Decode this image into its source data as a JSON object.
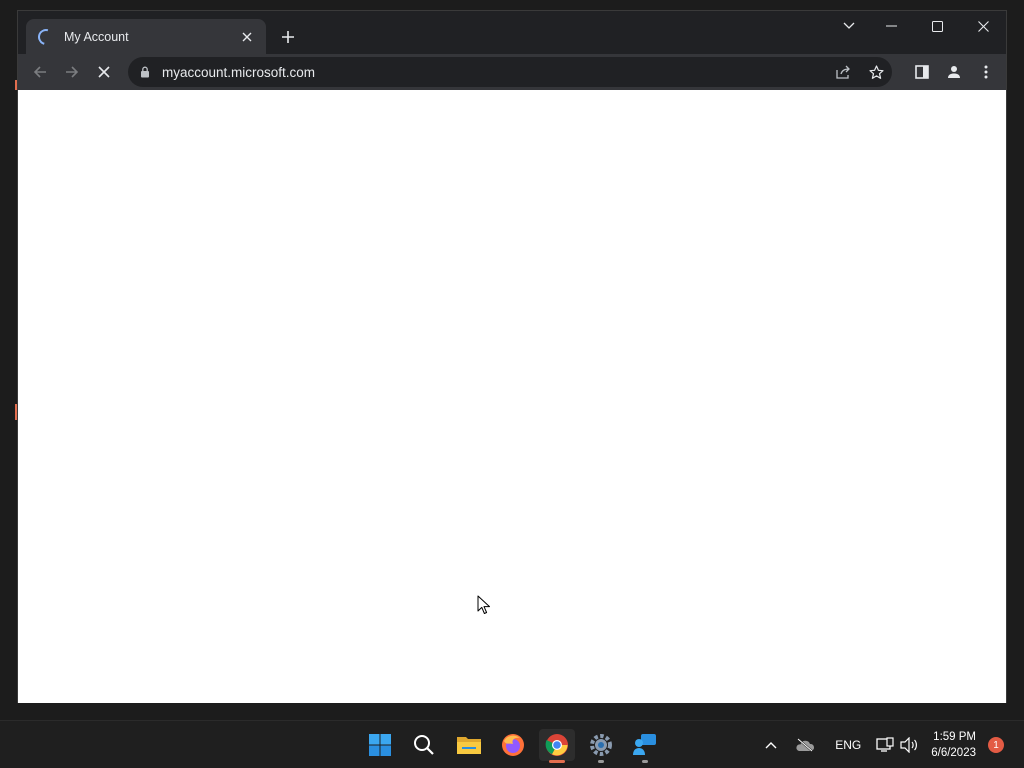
{
  "browser": {
    "tab": {
      "title": "My Account",
      "loading": true
    },
    "address_bar": {
      "url": "myaccount.microsoft.com",
      "secure": true
    },
    "icons": [
      "tab-search-icon",
      "minimize-icon",
      "maximize-icon",
      "close-icon",
      "back-icon",
      "forward-icon",
      "stop-loading-icon",
      "lock-icon",
      "share-icon",
      "bookmark-star-icon",
      "side-panel-icon",
      "profile-icon",
      "menu-icon"
    ],
    "content": {}
  },
  "taskbar": {
    "apps": [
      {
        "name": "Start",
        "icon": "windows-logo-icon"
      },
      {
        "name": "Search",
        "icon": "search-icon"
      },
      {
        "name": "File Explorer",
        "icon": "folder-icon"
      },
      {
        "name": "Firefox",
        "icon": "firefox-icon"
      },
      {
        "name": "Google Chrome",
        "icon": "chrome-icon",
        "active": true
      },
      {
        "name": "Settings",
        "icon": "settings-gear-icon"
      },
      {
        "name": "Chat",
        "icon": "chat-icon"
      }
    ],
    "tray": {
      "language": "ENG",
      "time": "1:59 PM",
      "date": "6/6/2023",
      "notification_count": "1"
    }
  },
  "colors": {
    "accent_blue": "#8ab4f8",
    "active_indicator": "#e36e4f",
    "notification": "#e35b44"
  }
}
